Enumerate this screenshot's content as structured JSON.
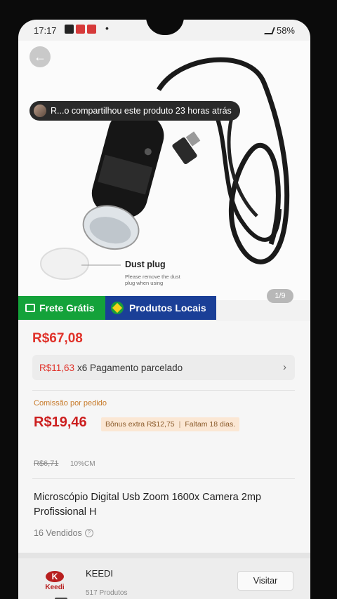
{
  "status": {
    "time": "17:17",
    "battery": "58%"
  },
  "share_banner": {
    "text": "R...o compartilhou este produto 23 horas atrás"
  },
  "image": {
    "dust_title": "Dust plug",
    "dust_note": "Please remove the dust plug when using",
    "counter": "1/9"
  },
  "badges": {
    "free_shipping": "Frete Grátis",
    "local_products": "Produtos Locais"
  },
  "price": {
    "value": "R$67,08"
  },
  "installment": {
    "amount": "R$11,63",
    "text": "x6 Pagamento parcelado"
  },
  "commission": {
    "label": "Comissão por pedido",
    "value": "R$19,46",
    "bonus": "Bônus extra R$12,75",
    "remaining": "Faltam 18 dias.",
    "old_value": "R$6,71",
    "percent": "10%CM"
  },
  "product": {
    "title": "Microscópio Digital Usb Zoom 1600x Camera 2mp Profissional H",
    "sold": "16 Vendidos"
  },
  "store": {
    "logo_text": "Keedi",
    "name": "KEEDI",
    "products": "517 Produtos",
    "visit_label": "Visitar"
  },
  "colors": {
    "price_red": "#e0322a",
    "green_badge": "#14a23a",
    "blue_badge": "#1a3f97"
  },
  "icons": [
    "back-arrow-icon",
    "help-icon",
    "chevron-right-icon",
    "truck-icon",
    "brazil-flag-icon"
  ]
}
